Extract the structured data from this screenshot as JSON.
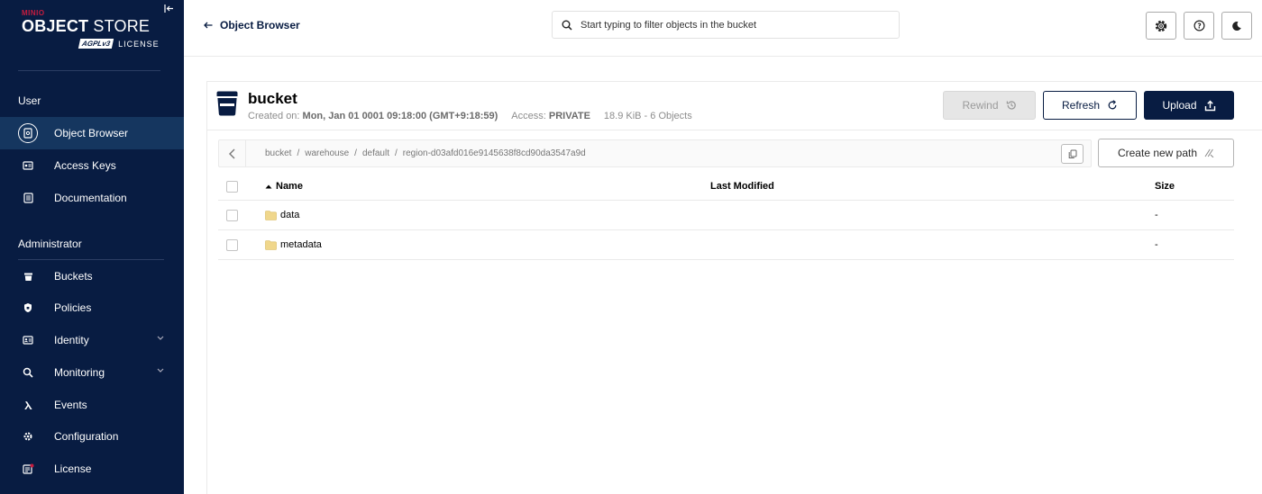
{
  "sidebar": {
    "brand": "MINIO",
    "product_bold": "OBJECT",
    "product_light": "STORE",
    "license_badge": "AGPLv3",
    "license_text": "LICENSE",
    "sections": {
      "user": "User",
      "admin": "Administrator"
    },
    "user_items": [
      {
        "label": "Object Browser",
        "icon": "object-browser-icon"
      },
      {
        "label": "Access Keys",
        "icon": "key-icon"
      },
      {
        "label": "Documentation",
        "icon": "document-icon"
      }
    ],
    "admin_items": [
      {
        "label": "Buckets",
        "icon": "bucket-icon"
      },
      {
        "label": "Policies",
        "icon": "shield-icon"
      },
      {
        "label": "Identity",
        "icon": "id-card-icon"
      },
      {
        "label": "Monitoring",
        "icon": "magnifier-icon"
      },
      {
        "label": "Events",
        "icon": "lambda-icon"
      },
      {
        "label": "Configuration",
        "icon": "gear-icon"
      },
      {
        "label": "License",
        "icon": "license-icon"
      }
    ]
  },
  "topbar": {
    "back_label": "Object Browser",
    "search_placeholder": "Start typing to filter objects in the bucket"
  },
  "bucket": {
    "name": "bucket",
    "created_label": "Created on:",
    "created_value": "Mon, Jan 01 0001 09:18:00 (GMT+9:18:59)",
    "access_label": "Access:",
    "access_value": "PRIVATE",
    "stats": "18.9 KiB - 6 Objects"
  },
  "actions": {
    "rewind": "Rewind",
    "refresh": "Refresh",
    "upload": "Upload",
    "new_path": "Create new path"
  },
  "breadcrumb": [
    "bucket",
    "warehouse",
    "default",
    "region-d03afd016e9145638f8cd90da3547a9d"
  ],
  "table": {
    "columns": {
      "name": "Name",
      "modified": "Last Modified",
      "size": "Size"
    },
    "rows": [
      {
        "name": "data",
        "modified": "",
        "size": "-"
      },
      {
        "name": "metadata",
        "modified": "",
        "size": "-"
      }
    ]
  },
  "colors": {
    "sidebar": "#081c42",
    "active": "#15365f",
    "accent": "#c51c3f",
    "folder": "#f0d78c"
  }
}
